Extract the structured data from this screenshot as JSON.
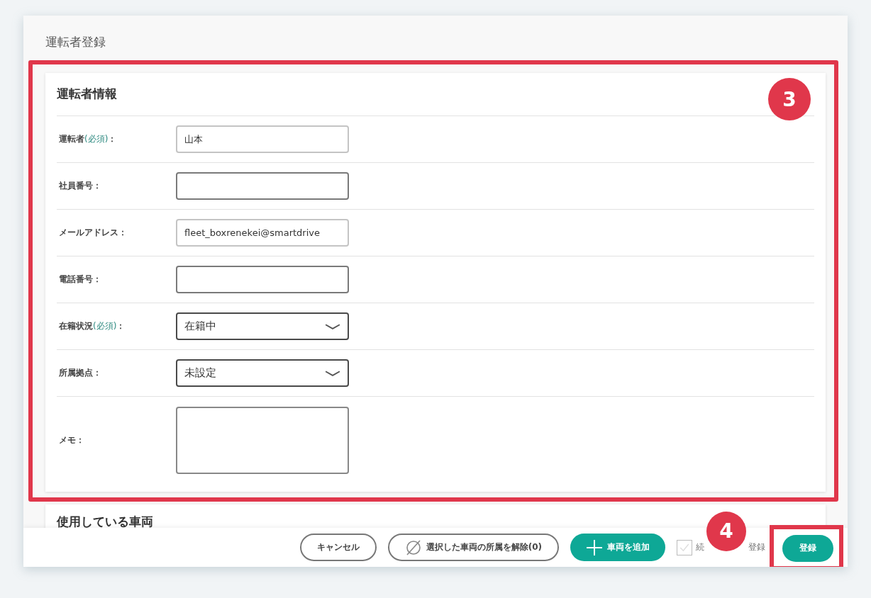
{
  "page_title": "運転者登録",
  "annotations": [
    {
      "number": "3"
    },
    {
      "number": "4"
    }
  ],
  "driver_info": {
    "heading": "運転者情報",
    "fields": [
      {
        "kind": "text",
        "label": "運転者",
        "note": "(必須)",
        "colon": "：",
        "value": "山本"
      },
      {
        "kind": "text",
        "label": "社員番号",
        "colon": "："
      },
      {
        "kind": "text",
        "label": "メールアドレス",
        "colon": "：",
        "value": "fleet_boxrenekei@smartdrive"
      },
      {
        "kind": "text",
        "label": "電話番号",
        "colon": "："
      },
      {
        "kind": "select",
        "label": "在籍状況",
        "note": "(必須)",
        "colon": "：",
        "value": "在籍中"
      },
      {
        "kind": "select",
        "label": "所属拠点",
        "colon": "：",
        "value": "未設定"
      },
      {
        "kind": "textarea",
        "label": "メモ",
        "colon": "："
      }
    ]
  },
  "vehicles": {
    "heading": "使用している車両"
  },
  "footer": {
    "buttons": [
      {
        "kind": "outline",
        "label": "キャンセル"
      },
      {
        "kind": "clear",
        "label": "選択した車両の所属を解除(0)"
      },
      {
        "kind": "add",
        "label": "車両を追加"
      }
    ],
    "continue_checkbox": {
      "checked": false,
      "label_parts": [
        "続",
        "登録"
      ]
    },
    "submit": {
      "kind": "primary",
      "label": "登録"
    }
  }
}
